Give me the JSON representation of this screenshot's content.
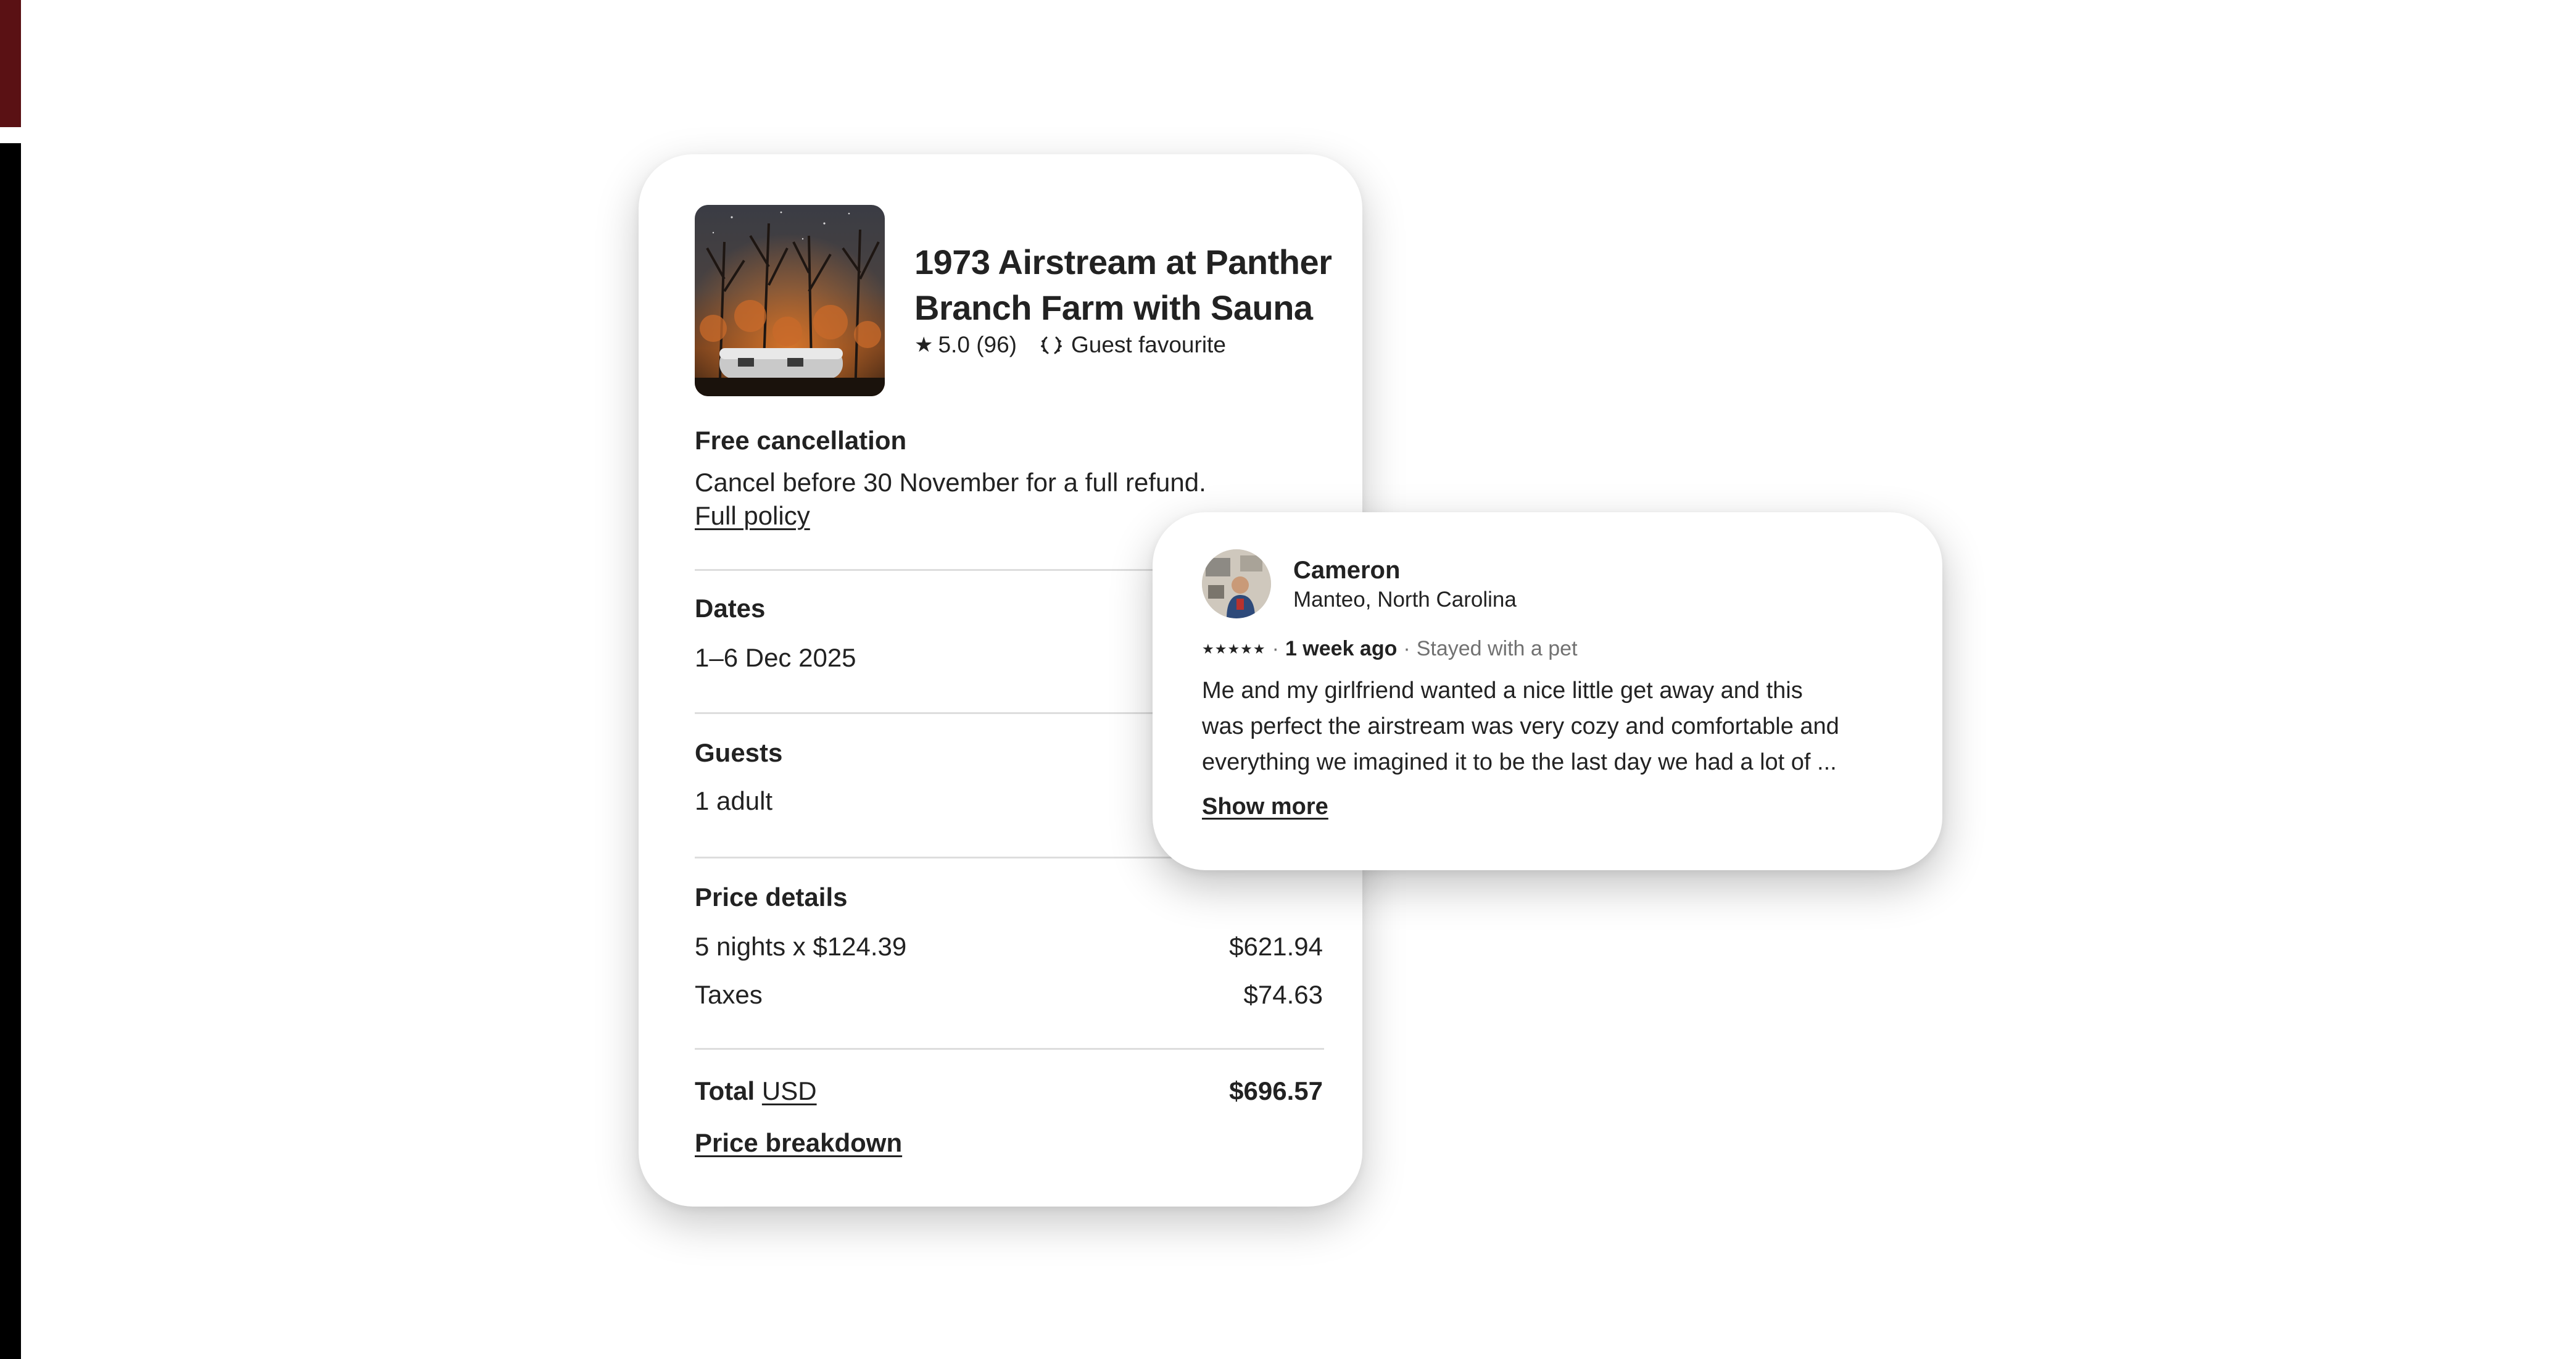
{
  "listing": {
    "title": "1973 Airstream at Panther Branch Farm with Sauna",
    "rating": "5.0 (96)",
    "badge": "Guest favourite",
    "thumbnail_icon": "airstream-forest-photo"
  },
  "cancellation": {
    "heading": "Free cancellation",
    "text": "Cancel before 30 November for a full refund.",
    "link": "Full policy"
  },
  "dates": {
    "heading": "Dates",
    "value": "1–6 Dec 2025"
  },
  "guests": {
    "heading": "Guests",
    "value": "1 adult"
  },
  "price": {
    "heading": "Price details",
    "nights_label": "5 nights x $124.39",
    "nights_value": "$621.94",
    "taxes_label": "Taxes",
    "taxes_value": "$74.63",
    "total_label": "Total",
    "currency": "USD",
    "total_value": "$696.57",
    "breakdown_link": "Price breakdown"
  },
  "review": {
    "name": "Cameron",
    "location": "Manteo, North Carolina",
    "stars": "★★★★★",
    "rating_value": 5,
    "when": "1 week ago",
    "stayed": "Stayed with a pet",
    "lines": [
      "Me and my girlfriend wanted a nice little get away and this",
      "was perfect the airstream was very cozy and comfortable and",
      "everything we imagined it to be  the last day we had a lot of ..."
    ],
    "show_more": "Show more"
  },
  "colors": {
    "text": "#222222",
    "muted": "#717171",
    "divider": "#dddddd",
    "edge_top": "#5a1114",
    "edge_bottom": "#000000"
  }
}
